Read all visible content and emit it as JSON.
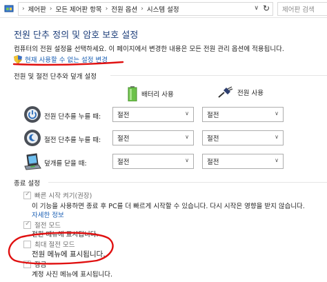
{
  "address_bar": {
    "breadcrumbs": [
      "제어판",
      "모든 제어판 항목",
      "전원 옵션",
      "시스템 설정"
    ],
    "search_placeholder": "제어판 검색"
  },
  "page": {
    "title": "전원 단추 정의 및 암호 보호 설정",
    "description": "컴퓨터의 전원 설정을 선택하세요. 이 페이지에서 변경한 내용은 모든 전원 관리 옵션에 적용됩니다.",
    "change_link": "현재 사용할 수 없는 설정 변경"
  },
  "buttons_section": {
    "label": "전원 및 절전 단추와 덮개 설정",
    "col_battery": "배터리 사용",
    "col_plugged": "전원 사용",
    "rows": [
      {
        "label": "전원 단추를 누를 때:",
        "battery": "절전",
        "plugged": "절전"
      },
      {
        "label": "절전 단추를 누를 때:",
        "battery": "절전",
        "plugged": "절전"
      },
      {
        "label": "덮개를 닫을 때:",
        "battery": "절전",
        "plugged": "절전"
      }
    ]
  },
  "shutdown_section": {
    "label": "종료 설정",
    "items": [
      {
        "label": "빠른 시작 켜기(권장)",
        "checked": true,
        "desc": "이 기능을 사용하면 종료 후 PC를 더 빠르게 시작할 수 있습니다. 다시 시작은 영향을 받지 않습니다.",
        "link": "자세한 정보"
      },
      {
        "label": "절전 모드",
        "checked": true,
        "desc": "전원 메뉴에 표시됩니다."
      },
      {
        "label": "최대 절전 모드",
        "checked": false,
        "desc": "전원 메뉴에 표시됩니다."
      },
      {
        "label": "잠금",
        "checked": true,
        "desc": "계정 사진 메뉴에 표시됩니다."
      }
    ]
  },
  "colors": {
    "title": "#1d3e7a",
    "link": "#1a5fb4",
    "annotation": "#e01010"
  }
}
